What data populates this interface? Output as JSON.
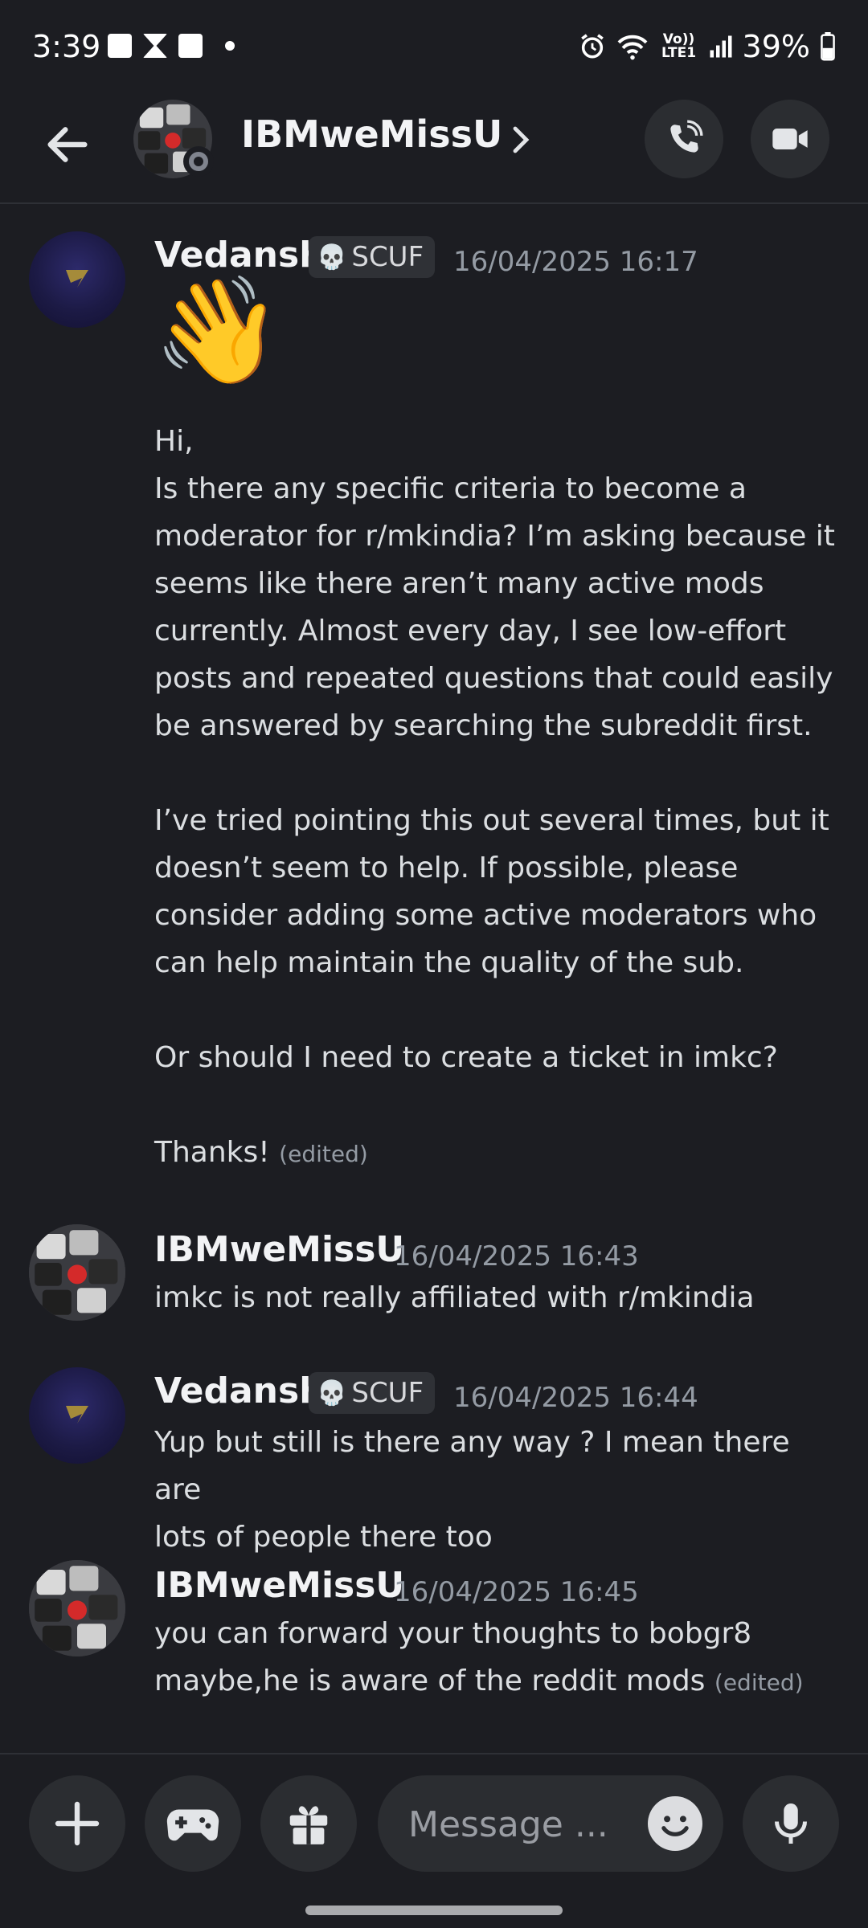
{
  "status_bar": {
    "time": "3:39",
    "network": "Vo)) LTE1",
    "battery": "39%"
  },
  "header": {
    "title": "IBMweMissU"
  },
  "messages": [
    {
      "author": "Vedansh",
      "badge": "SCUF",
      "timestamp": "16/04/2025 16:17",
      "emoji": "👋",
      "lines": [
        "Hi,",
        "Is there any specific criteria to become a",
        "moderator for r/mkindia? I’m asking because it",
        "seems like there aren’t many active mods",
        "currently. Almost every day, I see low-effort",
        "posts and repeated questions that could easily",
        "be answered by searching the subreddit first.",
        "",
        "I’ve tried pointing this out several times, but it",
        "doesn’t seem to help. If possible, please",
        "consider adding some active moderators who",
        "can help maintain the quality of the sub.",
        "",
        "Or should I need to create a ticket in imkc?",
        "",
        "Thanks!"
      ],
      "edited": "(edited)"
    },
    {
      "author": "IBMweMissU",
      "timestamp": "16/04/2025 16:43",
      "lines": [
        "imkc is not really affiliated with r/mkindia"
      ]
    },
    {
      "author": "Vedansh",
      "badge": "SCUF",
      "timestamp": "16/04/2025 16:44",
      "lines": [
        "Yup but still is there any way ? I mean there are",
        "lots of people there too"
      ]
    },
    {
      "author": "IBMweMissU",
      "timestamp": "16/04/2025 16:45",
      "lines": [
        "you can forward your thoughts to bobgr8",
        "maybe,he is aware of the reddit mods"
      ],
      "edited": "(edited)"
    }
  ],
  "composer": {
    "placeholder": "Message ..."
  },
  "colors": {
    "background": "#1c1d22",
    "surface": "#2b2d31",
    "muted_text": "#949ba4",
    "status_idle": "#80848e"
  }
}
